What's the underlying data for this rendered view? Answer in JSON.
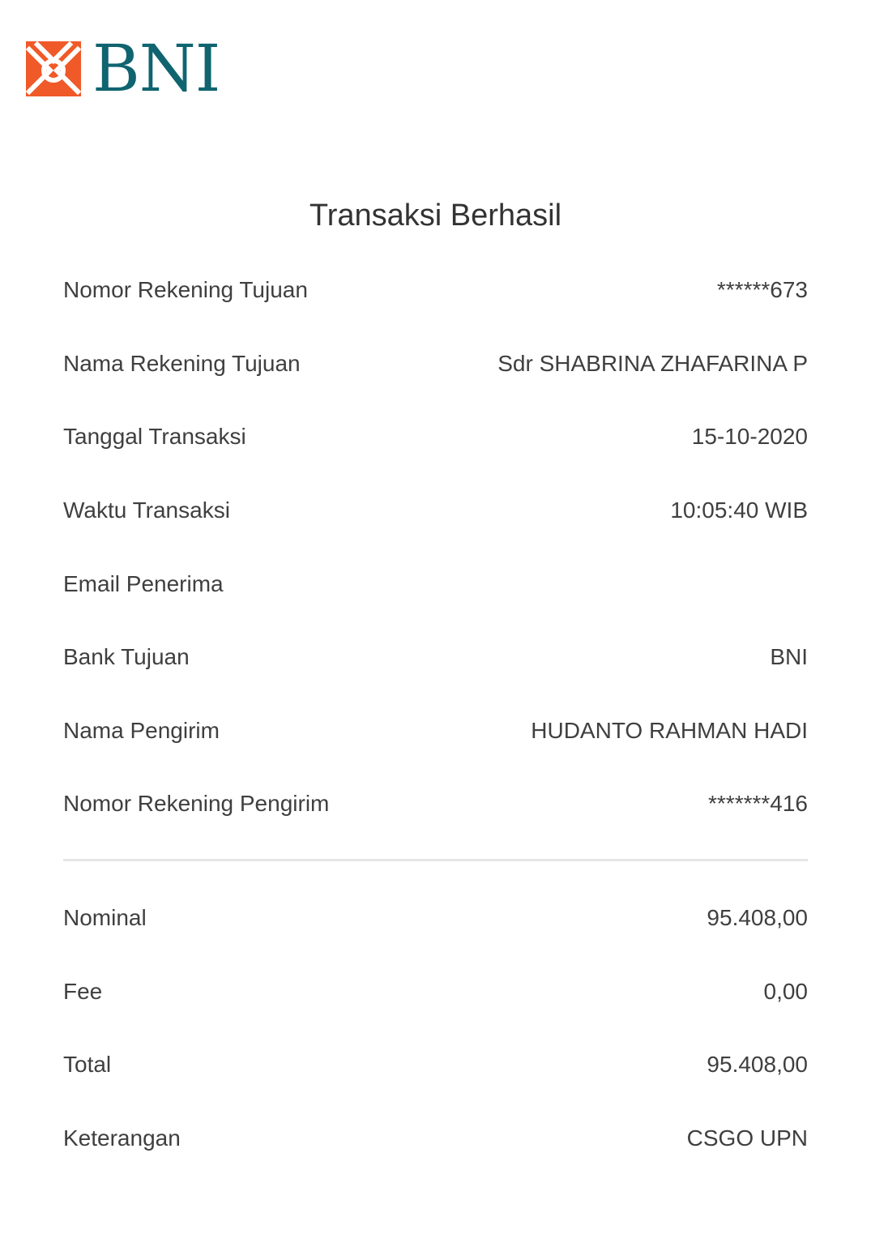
{
  "brand": {
    "name": "BNI",
    "logo_icon": "bni-logo-icon",
    "primary_color": "#0f6470",
    "accent_color": "#f05a28"
  },
  "title": "Transaksi Berhasil",
  "details": [
    {
      "label": "Nomor Rekening Tujuan",
      "value": "******673"
    },
    {
      "label": "Nama Rekening Tujuan",
      "value": "Sdr SHABRINA ZHAFARINA P"
    },
    {
      "label": "Tanggal Transaksi",
      "value": "15-10-2020"
    },
    {
      "label": "Waktu Transaksi",
      "value": "10:05:40 WIB"
    },
    {
      "label": "Email Penerima",
      "value": ""
    },
    {
      "label": "Bank Tujuan",
      "value": "BNI"
    },
    {
      "label": "Nama Pengirim",
      "value": "HUDANTO RAHMAN HADI"
    },
    {
      "label": "Nomor Rekening Pengirim",
      "value": "*******416"
    }
  ],
  "amounts": [
    {
      "label": "Nominal",
      "value": "95.408,00"
    },
    {
      "label": "Fee",
      "value": "0,00"
    },
    {
      "label": "Total",
      "value": "95.408,00"
    },
    {
      "label": "Keterangan",
      "value": "CSGO UPN"
    }
  ]
}
